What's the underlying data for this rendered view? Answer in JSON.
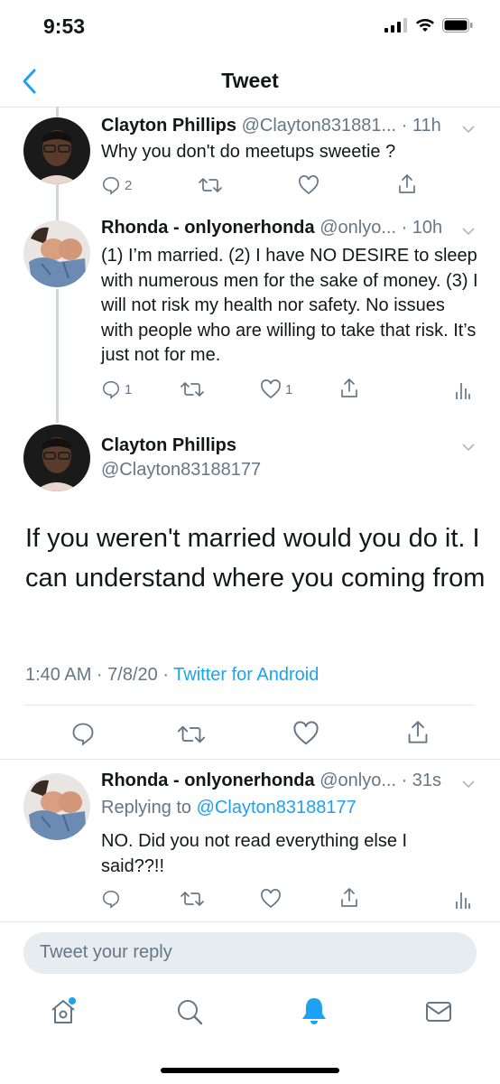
{
  "status": {
    "time": "9:53"
  },
  "nav": {
    "title": "Tweet"
  },
  "tweets": [
    {
      "name": "Clayton Phillips",
      "handle": "@Clayton831881...",
      "time": "· 11h",
      "text": "Why you don't do meetups sweetie ?",
      "reply_count": "2",
      "retweet_count": "",
      "like_count": ""
    },
    {
      "name": "Rhonda - onlyonerhonda",
      "handle": "@onlyo...",
      "time": "· 10h",
      "text": "(1) I’m married. (2) I have NO DESIRE to sleep with numerous men for the sake of money. (3) I will not risk my health nor safety. No issues with people who are willing to take that risk. It’s just not for me.",
      "reply_count": "1",
      "retweet_count": "",
      "like_count": "1"
    }
  ],
  "main_tweet": {
    "name": "Clayton Phillips",
    "handle": "@Clayton83188177",
    "text": "If you weren't married would you do it. I can understand where you coming from",
    "timestamp": "1:40 AM · 7/8/20 · ",
    "source": "Twitter for Android"
  },
  "reply_tweet": {
    "name": "Rhonda - onlyonerhonda",
    "handle": "@onlyo...",
    "time": "· 31s",
    "replying_prefix": "Replying to ",
    "replying_to": "@Clayton83188177",
    "text": "NO. Did you not read everything else I said??!!"
  },
  "composer": {
    "placeholder": "Tweet your reply"
  },
  "tabbar": {
    "items": [
      "home-icon",
      "search-icon",
      "notifications-icon",
      "messages-icon"
    ]
  },
  "colors": {
    "accent": "#1da1f2",
    "muted": "#657786",
    "border": "#e1e8ed",
    "text": "#14171a"
  }
}
